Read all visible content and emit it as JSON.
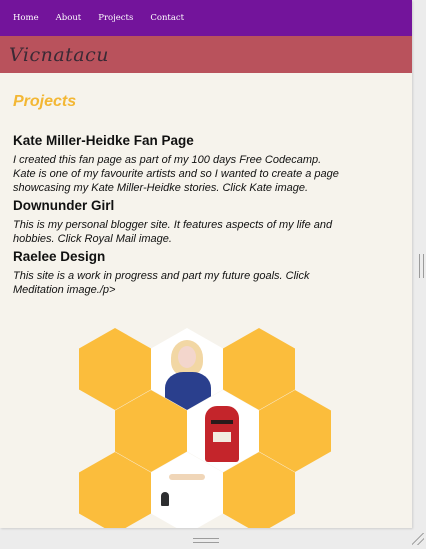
{
  "nav": {
    "items": [
      {
        "label": "Home"
      },
      {
        "label": "About"
      },
      {
        "label": "Projects"
      },
      {
        "label": "Contact"
      }
    ]
  },
  "banner": {
    "logo_text": "Vicnatacu"
  },
  "main": {
    "section_title": "Projects",
    "projects": [
      {
        "title": "Kate Miller-Heidke Fan Page",
        "description": "I created this fan page as part of my 100 days Free Codecamp. Kate is one of my favourite artists and so I wanted to create a page showcasing my Kate Miller-Heidke stories. Click Kate image."
      },
      {
        "title": "Downunder Girl",
        "description": "This is my personal blogger site. It features aspects of my life and hobbies. Click Royal Mail image."
      },
      {
        "title": "Raelee Design",
        "description": "This site is a work in progress and part my future goals. Click Meditation image./p>"
      }
    ]
  },
  "colors": {
    "nav_bg": "#73149b",
    "banner_bg": "#b9525c",
    "accent": "#f3b734",
    "hex_fill": "#fbbd3c",
    "page_bg": "#f6f3ec"
  },
  "hex_images": [
    "kate-image",
    "royal-mail-image",
    "meditation-image"
  ]
}
